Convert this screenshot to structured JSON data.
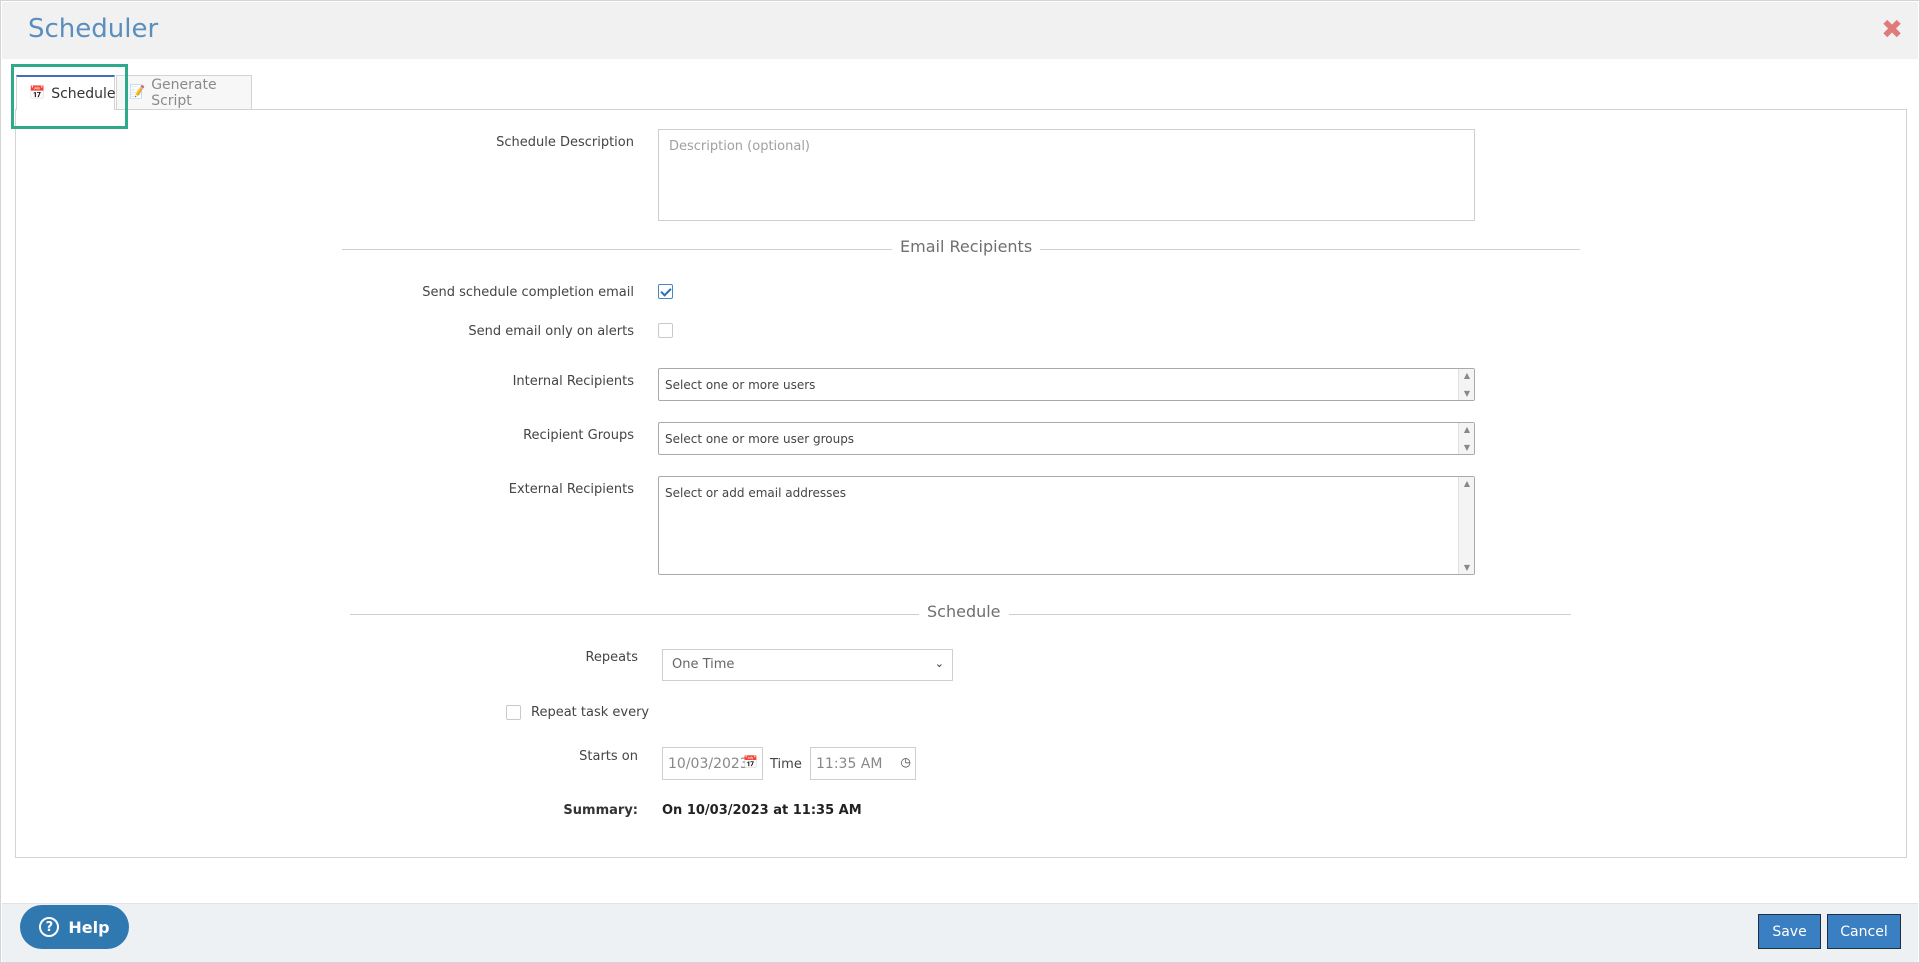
{
  "dialog": {
    "title": "Scheduler",
    "close_icon": "close-icon"
  },
  "tabs": [
    {
      "label": "Schedule",
      "icon": "calendar-icon",
      "active": true
    },
    {
      "label": "Generate Script",
      "icon": "script-icon",
      "active": false
    }
  ],
  "form": {
    "description": {
      "label": "Schedule Description",
      "placeholder": "Description (optional)",
      "value": ""
    },
    "email_section": {
      "title": "Email Recipients",
      "send_completion": {
        "label": "Send schedule completion email",
        "checked": true
      },
      "alerts_only": {
        "label": "Send email only on alerts",
        "checked": false
      },
      "internal": {
        "label": "Internal Recipients",
        "placeholder": "Select one or more users"
      },
      "groups": {
        "label": "Recipient Groups",
        "placeholder": "Select one or more user groups"
      },
      "external": {
        "label": "External Recipients",
        "placeholder": "Select or add email addresses"
      }
    },
    "schedule_section": {
      "title": "Schedule",
      "repeats": {
        "label": "Repeats",
        "value": "One Time"
      },
      "repeat_task": {
        "label": "Repeat task every",
        "checked": false
      },
      "starts_on": {
        "label": "Starts on",
        "date": "10/03/2023",
        "time_label": "Time",
        "time": "11:35 AM"
      },
      "summary": {
        "label": "Summary:",
        "value": "On 10/03/2023 at 11:35 AM"
      }
    }
  },
  "footer": {
    "help_label": "Help",
    "save_label": "Save",
    "cancel_label": "Cancel"
  },
  "colors": {
    "title": "#5a8fbd",
    "accent": "#3a7fc1",
    "help_button": "#2f78b0",
    "highlight": "#2eaa8a",
    "close": "#e07b7b"
  }
}
